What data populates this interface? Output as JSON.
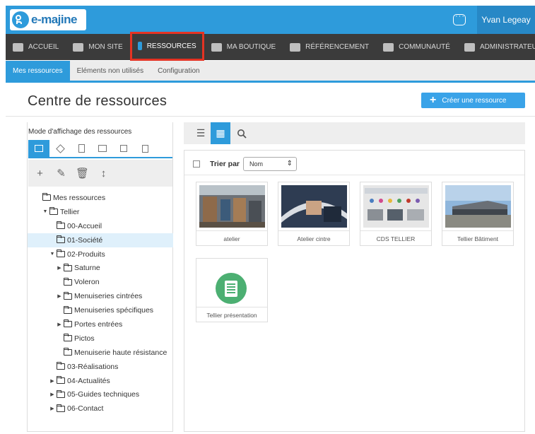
{
  "header": {
    "logo_text": "e-majine",
    "user_name": "Yvan Legeay"
  },
  "mainnav": [
    {
      "label": "ACCUEIL",
      "icon": "home-icon"
    },
    {
      "label": "MON SITE",
      "icon": "monitor-icon"
    },
    {
      "label": "RESSOURCES",
      "icon": "resources-icon"
    },
    {
      "label": "MA BOUTIQUE",
      "icon": "basket-icon"
    },
    {
      "label": "RÉFÉRENCEMENT",
      "icon": "trophy-icon"
    },
    {
      "label": "COMMUNAUTÉ",
      "icon": "users-icon"
    },
    {
      "label": "ADMINISTRATEURS",
      "icon": "crown-icon"
    }
  ],
  "subnav": [
    "Mes ressources",
    "Eléments non utilisés",
    "Configuration"
  ],
  "page": {
    "title": "Centre de ressources",
    "create_button": "Créer une ressource"
  },
  "left": {
    "mode_label": "Mode d'affichage des ressources"
  },
  "tree": [
    {
      "label": "Mes ressources",
      "depth": 0,
      "caret": ""
    },
    {
      "label": "Tellier",
      "depth": 1,
      "caret": "down"
    },
    {
      "label": "00-Accueil",
      "depth": 2,
      "caret": ""
    },
    {
      "label": "01-Société",
      "depth": 2,
      "caret": "",
      "selected": true
    },
    {
      "label": "02-Produits",
      "depth": 2,
      "caret": "down"
    },
    {
      "label": "Saturne",
      "depth": 3,
      "caret": "right"
    },
    {
      "label": "Voleron",
      "depth": 3,
      "caret": ""
    },
    {
      "label": "Menuiseries cintrées",
      "depth": 3,
      "caret": "right"
    },
    {
      "label": "Menuiseries spécifiques",
      "depth": 3,
      "caret": ""
    },
    {
      "label": "Portes entrées",
      "depth": 3,
      "caret": "right"
    },
    {
      "label": "Pictos",
      "depth": 3,
      "caret": ""
    },
    {
      "label": "Menuiserie haute résistance",
      "depth": 3,
      "caret": ""
    },
    {
      "label": "03-Réalisations",
      "depth": 2,
      "caret": ""
    },
    {
      "label": "04-Actualités",
      "depth": 2,
      "caret": "right"
    },
    {
      "label": "05-Guides techniques",
      "depth": 2,
      "caret": "right"
    },
    {
      "label": "06-Contact",
      "depth": 2,
      "caret": "right"
    }
  ],
  "sort": {
    "label": "Trier par",
    "value": "Nom"
  },
  "resources": [
    {
      "label": "atelier"
    },
    {
      "label": "Atelier cintre"
    },
    {
      "label": "CDS TELLIER"
    },
    {
      "label": "Tellier Bâtiment"
    },
    {
      "label": "Tellier présentation"
    }
  ]
}
